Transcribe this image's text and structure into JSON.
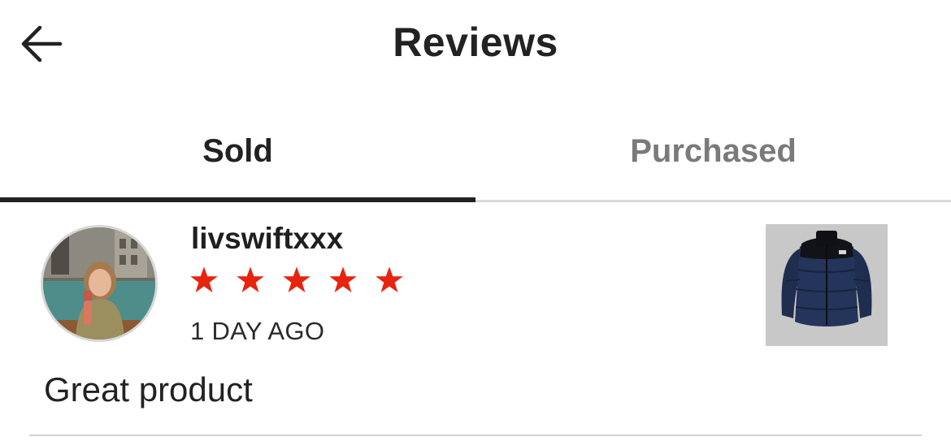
{
  "header": {
    "title": "Reviews",
    "back_icon": "arrow-left-icon"
  },
  "tabs": [
    {
      "label": "Sold",
      "active": true
    },
    {
      "label": "Purchased",
      "active": false
    }
  ],
  "reviews": [
    {
      "username": "livswiftxxx",
      "rating": 5,
      "max_rating": 5,
      "timestamp": "1 DAY AGO",
      "text": "Great product",
      "avatar": "profile-photo",
      "product_image": "navy-puffer-jacket"
    }
  ],
  "colors": {
    "star": "#e8230e",
    "active_tab": "#222222",
    "inactive_tab": "#7a7a7a",
    "divider": "#d3d3d3"
  }
}
